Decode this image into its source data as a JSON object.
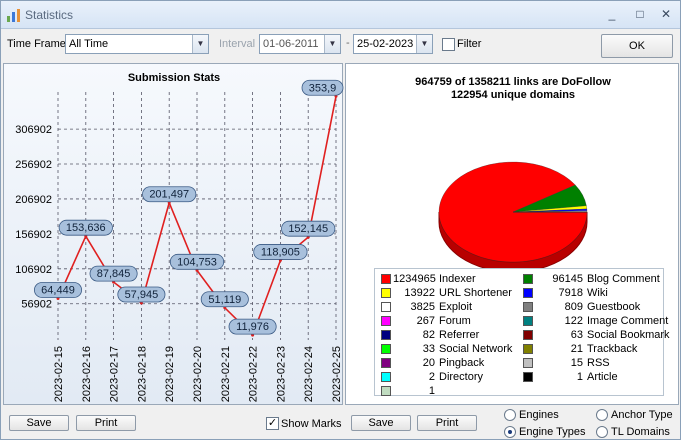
{
  "window": {
    "title": "Statistics",
    "controls": {
      "minimize": "_",
      "maximize": "□",
      "close": "✕"
    }
  },
  "toolbar": {
    "timeframe_label": "Time Frame",
    "timeframe_value": "All Time",
    "interval_label": "Interval",
    "start_date": "01-06-2011",
    "dash": "-",
    "end_date": "25-02-2023",
    "filter_label": "Filter",
    "filter_checked": false,
    "ok_label": "OK"
  },
  "chart_data": {
    "type": "line",
    "title": "Submission Stats",
    "x": [
      "2023-02-15",
      "2023-02-16",
      "2023-02-17",
      "2023-02-18",
      "2023-02-19",
      "2023-02-20",
      "2023-02-21",
      "2023-02-22",
      "2023-02-23",
      "2023-02-24",
      "2023-02-25"
    ],
    "values": [
      64449,
      153636,
      87845,
      57945,
      201497,
      104753,
      51119,
      11976,
      118905,
      152145,
      353905
    ],
    "data_labels": [
      "64,449",
      "153,636",
      "87,845",
      "57,945",
      "201,497",
      "104,753",
      "51,119",
      "11,976",
      "118,905",
      "152,145",
      "353,9"
    ],
    "y_ticks": [
      56902,
      106902,
      156902,
      206902,
      256902,
      306902
    ],
    "y_tick_labels": [
      "56902",
      "106902",
      "156902",
      "206902",
      "256902",
      "306902"
    ],
    "ylim": [
      5000,
      360000
    ],
    "grid": true,
    "line_color": "#e02020"
  },
  "pie": {
    "header_line1": "964759 of 1358211 links are DoFollow",
    "header_line2": "122954 unique domains",
    "slices": [
      {
        "name": "Indexer",
        "value": 1234965,
        "color": "#ff0000"
      },
      {
        "name": "Blog Comment",
        "value": 96145,
        "color": "#008000"
      },
      {
        "name": "URL Shortener",
        "value": 13922,
        "color": "#ffff00"
      },
      {
        "name": "Wiki",
        "value": 7918,
        "color": "#0000ff"
      },
      {
        "name": "Exploit",
        "value": 3825,
        "color": "#ffffff"
      },
      {
        "name": "Guestbook",
        "value": 809,
        "color": "#808080"
      },
      {
        "name": "Forum",
        "value": 267,
        "color": "#ff00ff"
      },
      {
        "name": "Image Comment",
        "value": 122,
        "color": "#008080"
      },
      {
        "name": "Referrer",
        "value": 82,
        "color": "#000080"
      },
      {
        "name": "Social Bookmark",
        "value": 63,
        "color": "#800000"
      },
      {
        "name": "Social Network",
        "value": 33,
        "color": "#00ff00"
      },
      {
        "name": "Trackback",
        "value": 21,
        "color": "#808000"
      },
      {
        "name": "Pingback",
        "value": 20,
        "color": "#800080"
      },
      {
        "name": "RSS",
        "value": 15,
        "color": "#c0c0c0"
      },
      {
        "name": "Directory",
        "value": 2,
        "color": "#00ffff"
      },
      {
        "name": "Article",
        "value": 1,
        "color": "#000000"
      },
      {
        "name": "",
        "value": 1,
        "color": "#c0dcc0"
      }
    ]
  },
  "legend": {
    "left": [
      {
        "count": "1234965",
        "name": "Indexer",
        "color": "#ff0000"
      },
      {
        "count": "13922",
        "name": "URL Shortener",
        "color": "#ffff00"
      },
      {
        "count": "3825",
        "name": "Exploit",
        "color": "#ffffff"
      },
      {
        "count": "267",
        "name": "Forum",
        "color": "#ff00ff"
      },
      {
        "count": "82",
        "name": "Referrer",
        "color": "#000080"
      },
      {
        "count": "33",
        "name": "Social Network",
        "color": "#00ff00"
      },
      {
        "count": "20",
        "name": "Pingback",
        "color": "#800080"
      },
      {
        "count": "2",
        "name": "Directory",
        "color": "#00ffff"
      },
      {
        "count": "1",
        "name": "",
        "color": "#c0dcc0"
      }
    ],
    "right": [
      {
        "count": "96145",
        "name": "Blog Comment",
        "color": "#008000"
      },
      {
        "count": "7918",
        "name": "Wiki",
        "color": "#0000ff"
      },
      {
        "count": "809",
        "name": "Guestbook",
        "color": "#808080"
      },
      {
        "count": "122",
        "name": "Image Comment",
        "color": "#008080"
      },
      {
        "count": "63",
        "name": "Social Bookmark",
        "color": "#800000"
      },
      {
        "count": "21",
        "name": "Trackback",
        "color": "#808000"
      },
      {
        "count": "15",
        "name": "RSS",
        "color": "#c0c0c0"
      },
      {
        "count": "1",
        "name": "Article",
        "color": "#000000"
      }
    ]
  },
  "bottom": {
    "save_label": "Save",
    "print_label": "Print",
    "show_marks_label": "Show Marks",
    "show_marks_checked": true,
    "save_label_right": "Save",
    "print_label_right": "Print",
    "radio_engines": "Engines",
    "radio_engine_types": "Engine Types",
    "radio_anchor_type": "Anchor Type",
    "radio_tl_domains": "TL Domains",
    "selected_radio": "Engine Types"
  }
}
